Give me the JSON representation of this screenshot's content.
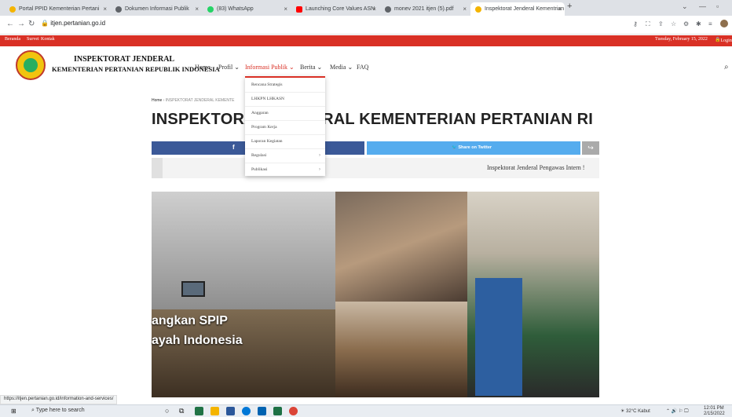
{
  "browser": {
    "tabs": [
      {
        "label": "Portal PPID Kementerian Pertani",
        "color": "#f4b400"
      },
      {
        "label": "Dokumen Informasi Publik",
        "color": "#5f6368"
      },
      {
        "label": "(83) WhatsApp",
        "color": "#25d366"
      },
      {
        "label": "Launching Core Values ASN",
        "color": "#ff0000"
      },
      {
        "label": "monev 2021 itjen (5).pdf",
        "color": "#5f6368"
      },
      {
        "label": "Inspektorat Jenderal Kementrian",
        "color": "#f4b400"
      }
    ],
    "url": "itjen.pertanian.go.id"
  },
  "topbar": {
    "links": [
      "Beranda",
      "Survei",
      "Kontak"
    ],
    "date": "Tuesday, February 15, 2022",
    "login": "Login"
  },
  "brand": {
    "line1": "INSPEKTORAT JENDERAL",
    "line2": "KEMENTERIAN PERTANIAN REPUBLIK INDONESIA"
  },
  "nav": {
    "items": [
      "Home",
      "Profil",
      "Informasi Publik",
      "Berita",
      "Media",
      "FAQ"
    ],
    "chevron": "⌄"
  },
  "dropdown": {
    "items": [
      "Rencana Strategis",
      "LHKPN LHKASN",
      "Anggaran",
      "Program Kerja",
      "Laporan Kegiatan",
      "Regulasi",
      "Publikasi"
    ]
  },
  "breadcrumb": {
    "home": "Home",
    "current": "INSPEKTORAT JENDERAL KEMENTE"
  },
  "page": {
    "title": "INSPEKTORAT JENDERAL KEMENTERIAN PERTANIAN RI",
    "share_twitter": "Share on Twitter",
    "ticker": "Inspektorat Jenderal Pengawas Intern !",
    "hero_line1": "angkan SPIP",
    "hero_line2": "ayah Indonesia"
  },
  "status_url": "https://itjen.pertanian.go.id/information-and-services/",
  "taskbar": {
    "search": "Type here to search",
    "weather": "32°C  Kabut",
    "time": "12:01 PM",
    "date": "2/15/2022"
  }
}
